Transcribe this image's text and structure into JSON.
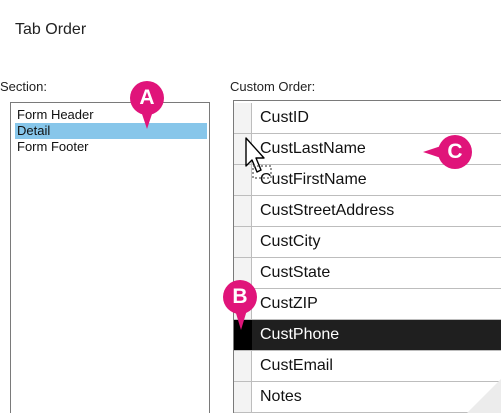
{
  "window": {
    "title": "Tab Order"
  },
  "section": {
    "label": "Section:",
    "items": [
      {
        "label": "Form Header",
        "selected": false
      },
      {
        "label": "Detail",
        "selected": true
      },
      {
        "label": "Form Footer",
        "selected": false
      }
    ]
  },
  "custom_order": {
    "label": "Custom Order:",
    "rows": [
      {
        "field": "CustID",
        "selected": false
      },
      {
        "field": "CustLastName",
        "selected": false
      },
      {
        "field": "CustFirstName",
        "selected": false
      },
      {
        "field": "CustStreetAddress",
        "selected": false
      },
      {
        "field": "CustCity",
        "selected": false
      },
      {
        "field": "CustState",
        "selected": false
      },
      {
        "field": "CustZIP",
        "selected": false
      },
      {
        "field": "CustPhone",
        "selected": true
      },
      {
        "field": "CustEmail",
        "selected": false
      },
      {
        "field": "Notes",
        "selected": false
      }
    ]
  },
  "callouts": {
    "a": "A",
    "b": "B",
    "c": "C"
  },
  "colors": {
    "callout": "#e0147a",
    "section_selected": "#87c6ea",
    "row_selected": "#1f1f1f"
  },
  "icons": {
    "cursor": "move-arrow-cursor-icon"
  }
}
